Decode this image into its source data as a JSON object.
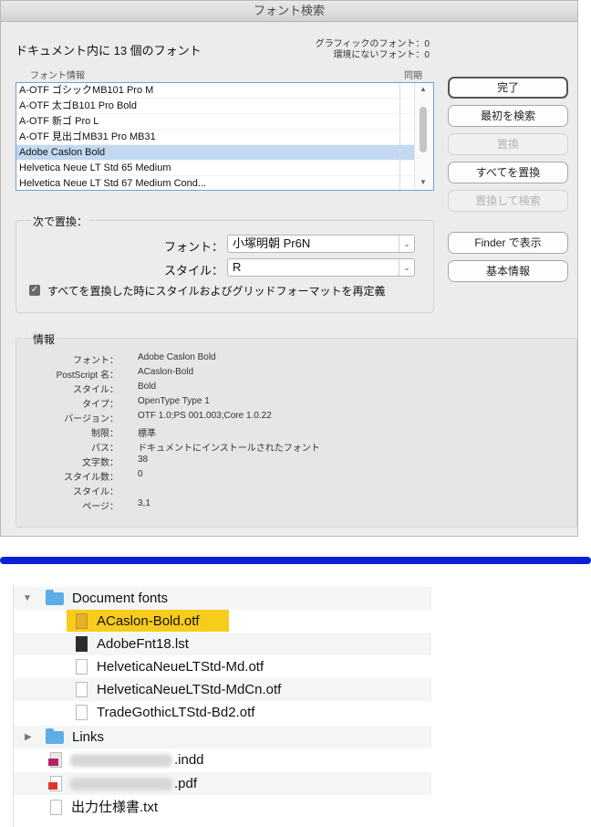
{
  "dialog": {
    "title": "フォント検索",
    "heading": "ドキュメント内に 13 個のフォント",
    "stats": {
      "graphic_fonts": "グラフィックのフォント：0",
      "missing_fonts": "環境にないフォント：0"
    },
    "list": {
      "col_font_info": "フォント情報",
      "col_sync": "同期",
      "rows": [
        "A-OTF ゴシックMB101 Pro M",
        "A-OTF 太ゴB101 Pro Bold",
        "A-OTF 新ゴ Pro L",
        "A-OTF 見出ゴMB31 Pro MB31",
        "Adobe Caslon Bold",
        "Helvetica Neue LT Std 65 Medium",
        "Helvetica Neue LT Std 67 Medium Cond..."
      ],
      "selected_index": 4
    },
    "buttons": {
      "done": "完了",
      "find_first": "最初を検索",
      "replace": "置換",
      "replace_all": "すべてを置換",
      "replace_and_find": "置換して検索",
      "reveal_in_finder": "Finder で表示",
      "more_info": "基本情報"
    },
    "replace_with": {
      "group_label": "次で置換：",
      "font_label": "フォント：",
      "font_value": "小塚明朝 Pr6N",
      "style_label": "スタイル：",
      "style_value": "R",
      "checkbox_label": "すべてを置換した時にスタイルおよびグリッドフォーマットを再定義",
      "checkbox_checked": true
    },
    "info": {
      "group_label": "情報",
      "rows": [
        {
          "key": "フォント：",
          "value": "Adobe Caslon Bold"
        },
        {
          "key": "PostScript 名：",
          "value": "ACaslon-Bold"
        },
        {
          "key": "スタイル：",
          "value": "Bold"
        },
        {
          "key": "タイプ：",
          "value": "OpenType Type 1"
        },
        {
          "key": "バージョン：",
          "value": "OTF 1.0;PS 001.003;Core 1.0.22"
        },
        {
          "key": "制限：",
          "value": "標準"
        },
        {
          "key": "パス：",
          "value": "ドキュメントにインストールされたフォント"
        },
        {
          "key": "文字数：",
          "value": "38"
        },
        {
          "key": "スタイル数：",
          "value": "0"
        },
        {
          "key": "スタイル：",
          "value": ""
        },
        {
          "key": "ページ：",
          "value": "3,1"
        }
      ]
    }
  },
  "finder": {
    "items": [
      {
        "name": "Document fonts",
        "kind": "folder",
        "expanded": true
      },
      {
        "name": "ACaslon-Bold.otf",
        "kind": "font",
        "highlighted": true
      },
      {
        "name": "AdobeFnt18.lst",
        "kind": "dark"
      },
      {
        "name": "HelveticaNeueLTStd-Md.otf",
        "kind": "font"
      },
      {
        "name": "HelveticaNeueLTStd-MdCn.otf",
        "kind": "font"
      },
      {
        "name": "TradeGothicLTStd-Bd2.otf",
        "kind": "font"
      },
      {
        "name": "Links",
        "kind": "folder",
        "expanded": false
      },
      {
        "name": ".indd",
        "kind": "indd"
      },
      {
        "name": ".pdf",
        "kind": "pdf"
      },
      {
        "name": "出力仕様書.txt",
        "kind": "text"
      }
    ]
  },
  "colors": {
    "divider": "#0d1fd6",
    "selection": "#c2d9f1",
    "finder_highlight": "#f8cc1c"
  }
}
